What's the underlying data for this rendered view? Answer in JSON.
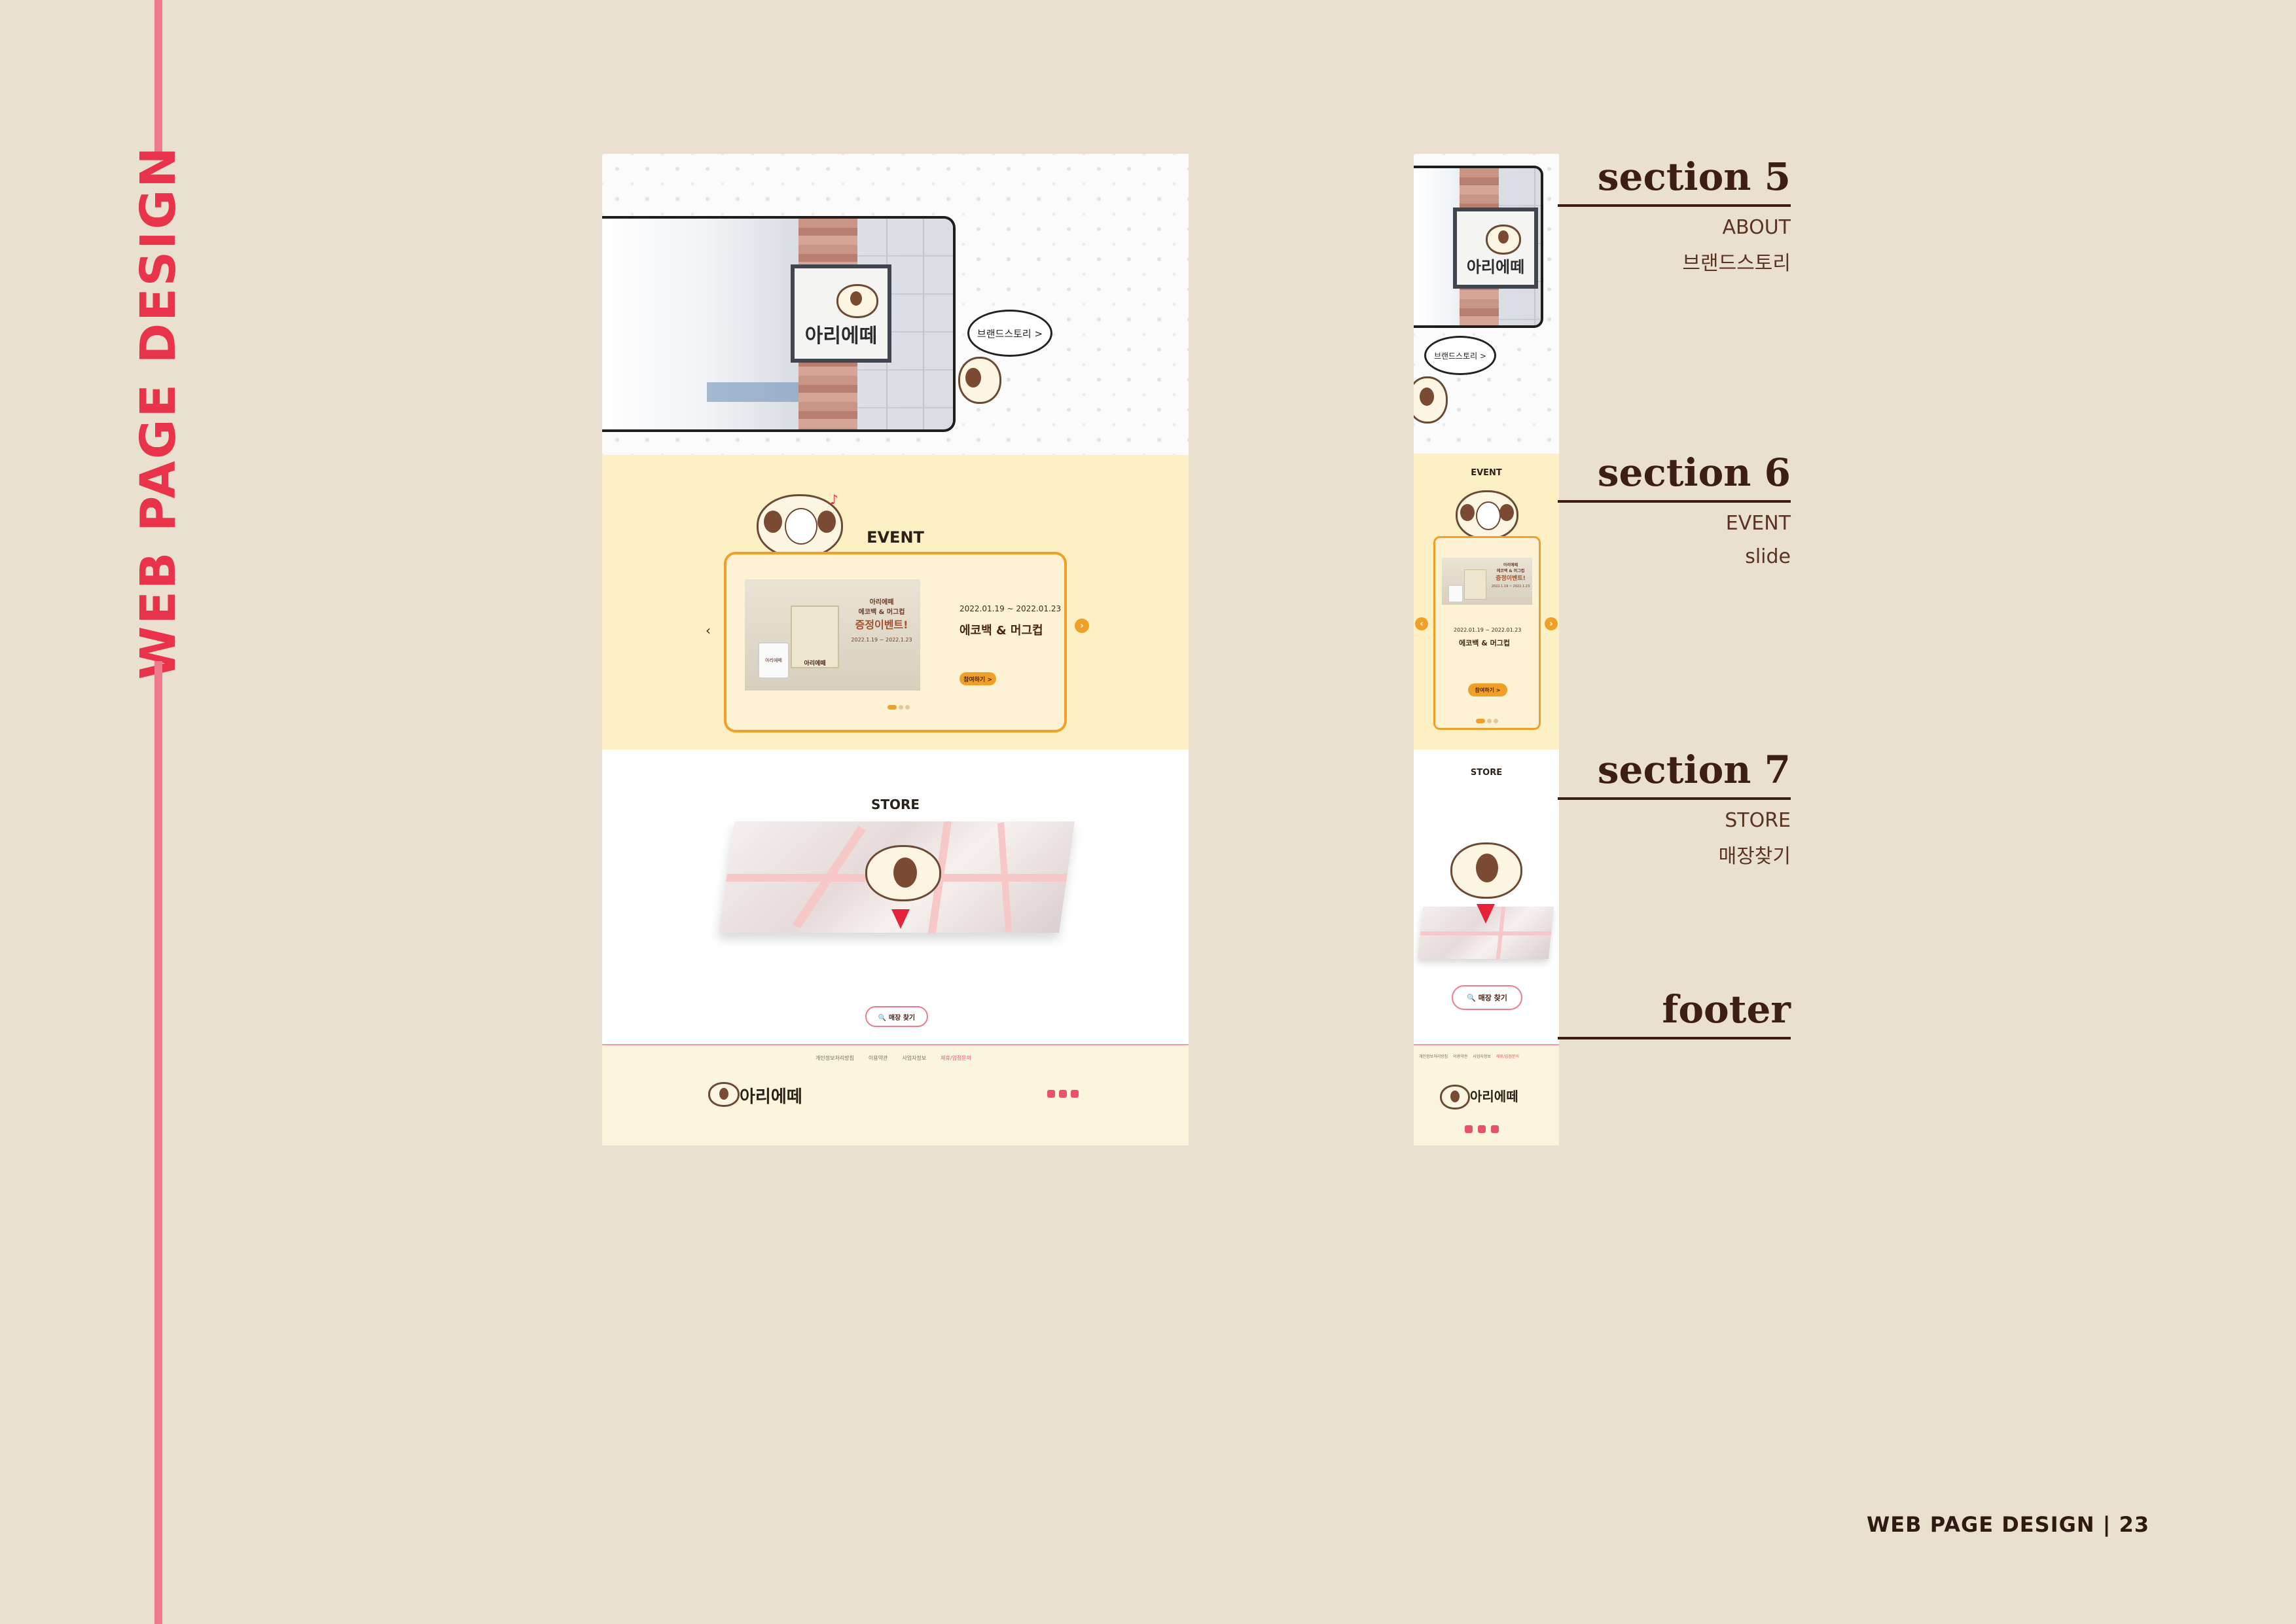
{
  "page": {
    "side_title": "WEB PAGE DESIGN",
    "footer_label": "WEB PAGE DESIGN | 23"
  },
  "desktop": {
    "hero": {
      "sign_text": "아리에떼",
      "bubble_text": "브랜드스토리 >"
    },
    "event": {
      "heading": "EVENT",
      "promo_lines": [
        "아리에떼",
        "에코백 & 머그컵",
        "증정이벤트!"
      ],
      "promo_date": "2022.1.19 ~ 2022.1.23",
      "mug_text": "아리에떼",
      "bag_text": "아리에떼",
      "date_range": "2022.01.19 ~ 2022.01.23",
      "product": "에코백 & 머그컵",
      "button": "참여하기 >",
      "prev": "‹",
      "next": "›"
    },
    "store": {
      "heading": "STORE",
      "button": "🔍 매장 찾기"
    },
    "footer": {
      "nav": [
        "개인정보처리방침",
        "이용약관",
        "사업자정보",
        "제휴/입점문의"
      ],
      "logo": "아리에떼"
    }
  },
  "mobile": {
    "hero": {
      "sign_text": "아리에떼",
      "bubble_text": "브랜드스토리 >"
    },
    "event": {
      "heading": "EVENT",
      "promo_lines": [
        "아리에떼",
        "에코백 & 머그컵",
        "증정이벤트!"
      ],
      "promo_date": "2022.1.19 ~ 2022.1.23",
      "date_range": "2022.01.19 ~ 2022.01.23",
      "product": "에코백 & 머그컵",
      "button": "참여하기 >",
      "prev": "‹",
      "next": "›"
    },
    "store": {
      "heading": "STORE",
      "button": "🔍 매장 찾기"
    },
    "footer": {
      "nav": [
        "개인정보처리방침",
        "이용약관",
        "사업자정보",
        "제휴/입점문의"
      ],
      "logo": "아리에떼"
    }
  },
  "sections": [
    {
      "title": "section 5",
      "sub1": "ABOUT",
      "sub2": "브랜드스토리"
    },
    {
      "title": "section 6",
      "sub1": "EVENT",
      "sub2": "slide"
    },
    {
      "title": "section 7",
      "sub1": "STORE",
      "sub2": "매장찾기"
    },
    {
      "title": "footer"
    }
  ],
  "colors": {
    "background": "#e9e0cf",
    "accent_pink": "#ee7a8d",
    "title_red": "#e8334a",
    "event_orange": "#f0a028",
    "event_bg": "#fdf0c4",
    "text_brown": "#3d1e12"
  },
  "icons": [
    "search-icon",
    "twitter-icon",
    "instagram-icon",
    "youtube-icon",
    "chevron-left-icon",
    "chevron-right-icon",
    "sheep-mascot-icon",
    "map-pin-icon"
  ]
}
